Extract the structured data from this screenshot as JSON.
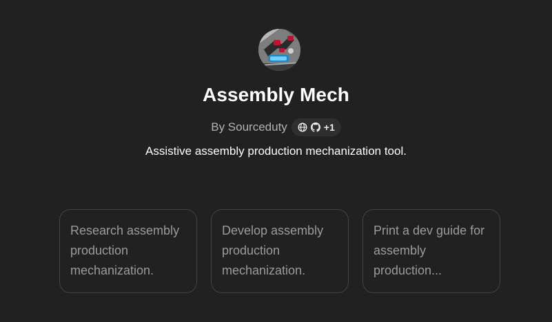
{
  "gpt": {
    "name": "Assembly Mech",
    "author": "By Sourceduty",
    "links_extra": "+1",
    "description": "Assistive assembly production mechanization tool."
  },
  "icons": {
    "avatar": "robot-arm-avatar",
    "website": "globe-icon",
    "github": "github-icon"
  },
  "conversation_starters": [
    {
      "text": "Research assembly production mechanization."
    },
    {
      "text": "Develop assembly production mechanization."
    },
    {
      "text": "Print a dev guide for assembly production..."
    }
  ],
  "colors": {
    "background": "#212121",
    "card_border": "#424242",
    "pill_background": "#2f2f2f",
    "muted_text": "#9b9b9b"
  }
}
